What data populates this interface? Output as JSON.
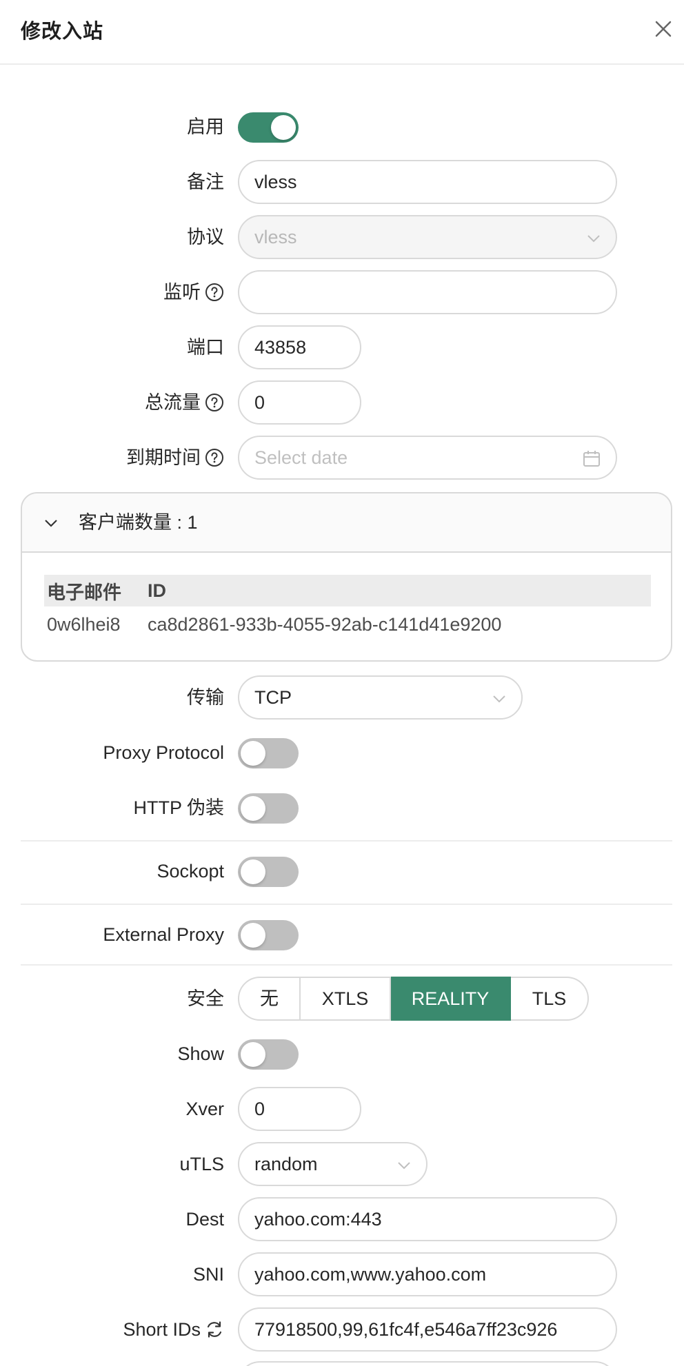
{
  "modal": {
    "title": "修改入站"
  },
  "form": {
    "enable_label": "启用",
    "enable_on": true,
    "remark_label": "备注",
    "remark_value": "vless",
    "protocol_label": "协议",
    "protocol_value": "vless",
    "listen_label": "监听",
    "listen_value": "",
    "port_label": "端口",
    "port_value": "43858",
    "traffic_label": "总流量",
    "traffic_value": "0",
    "expiry_label": "到期时间",
    "expiry_placeholder": "Select date"
  },
  "clients": {
    "header": "客户端数量 : 1",
    "columns": [
      "电子邮件",
      "ID"
    ],
    "rows": [
      {
        "email": "0w6lhei8",
        "id": "ca8d2861-933b-4055-92ab-c141d41e9200"
      }
    ]
  },
  "transport": {
    "label": "传输",
    "value": "TCP",
    "proxy_protocol_label": "Proxy Protocol",
    "proxy_protocol_on": false,
    "http_label": "HTTP 伪装",
    "http_on": false,
    "sockopt_label": "Sockopt",
    "sockopt_on": false,
    "external_proxy_label": "External Proxy",
    "external_proxy_on": false
  },
  "security": {
    "label": "安全",
    "options": [
      "无",
      "XTLS",
      "REALITY",
      "TLS"
    ],
    "selected": "REALITY",
    "show_label": "Show",
    "show_on": false,
    "xver_label": "Xver",
    "xver_value": "0",
    "utls_label": "uTLS",
    "utls_value": "random",
    "dest_label": "Dest",
    "dest_value": "yahoo.com:443",
    "sni_label": "SNI",
    "sni_value": "yahoo.com,www.yahoo.com",
    "short_ids_label": "Short IDs",
    "short_ids_value": "77918500,99,61fc4f,e546a7ff23c926"
  },
  "colors": {
    "primary": "#3a8a6e",
    "switch_off": "#bfbfbf",
    "border": "#d9d9d9"
  },
  "icons": {
    "close": "close-icon",
    "help": "question-circle-icon",
    "chevron": "chevron-down-icon",
    "calendar": "calendar-icon",
    "refresh": "refresh-icon"
  }
}
